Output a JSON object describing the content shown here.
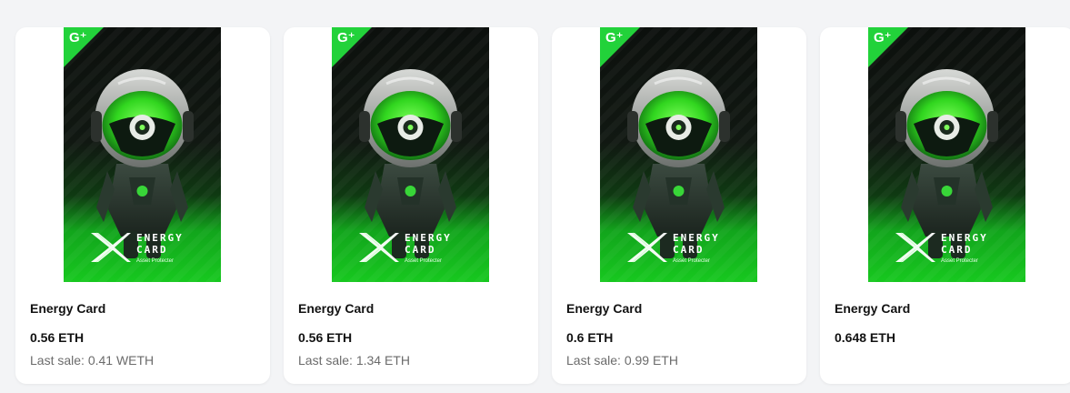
{
  "artwork": {
    "corner_logo": "G⁺",
    "brand_word_1": "ENERGY",
    "brand_word_2": "CARD",
    "brand_sub": "Asset Protecter",
    "accent_color": "#17c81f",
    "subject": "robot-astronaut-icon"
  },
  "cards": [
    {
      "name": "Energy Card",
      "price": "0.56 ETH",
      "last_sale": "Last sale: 0.41 WETH"
    },
    {
      "name": "Energy Card",
      "price": "0.56 ETH",
      "last_sale": "Last sale: 1.34 ETH"
    },
    {
      "name": "Energy Card",
      "price": "0.6 ETH",
      "last_sale": "Last sale: 0.99 ETH"
    },
    {
      "name": "Energy Card",
      "price": "0.648 ETH",
      "last_sale": ""
    }
  ]
}
